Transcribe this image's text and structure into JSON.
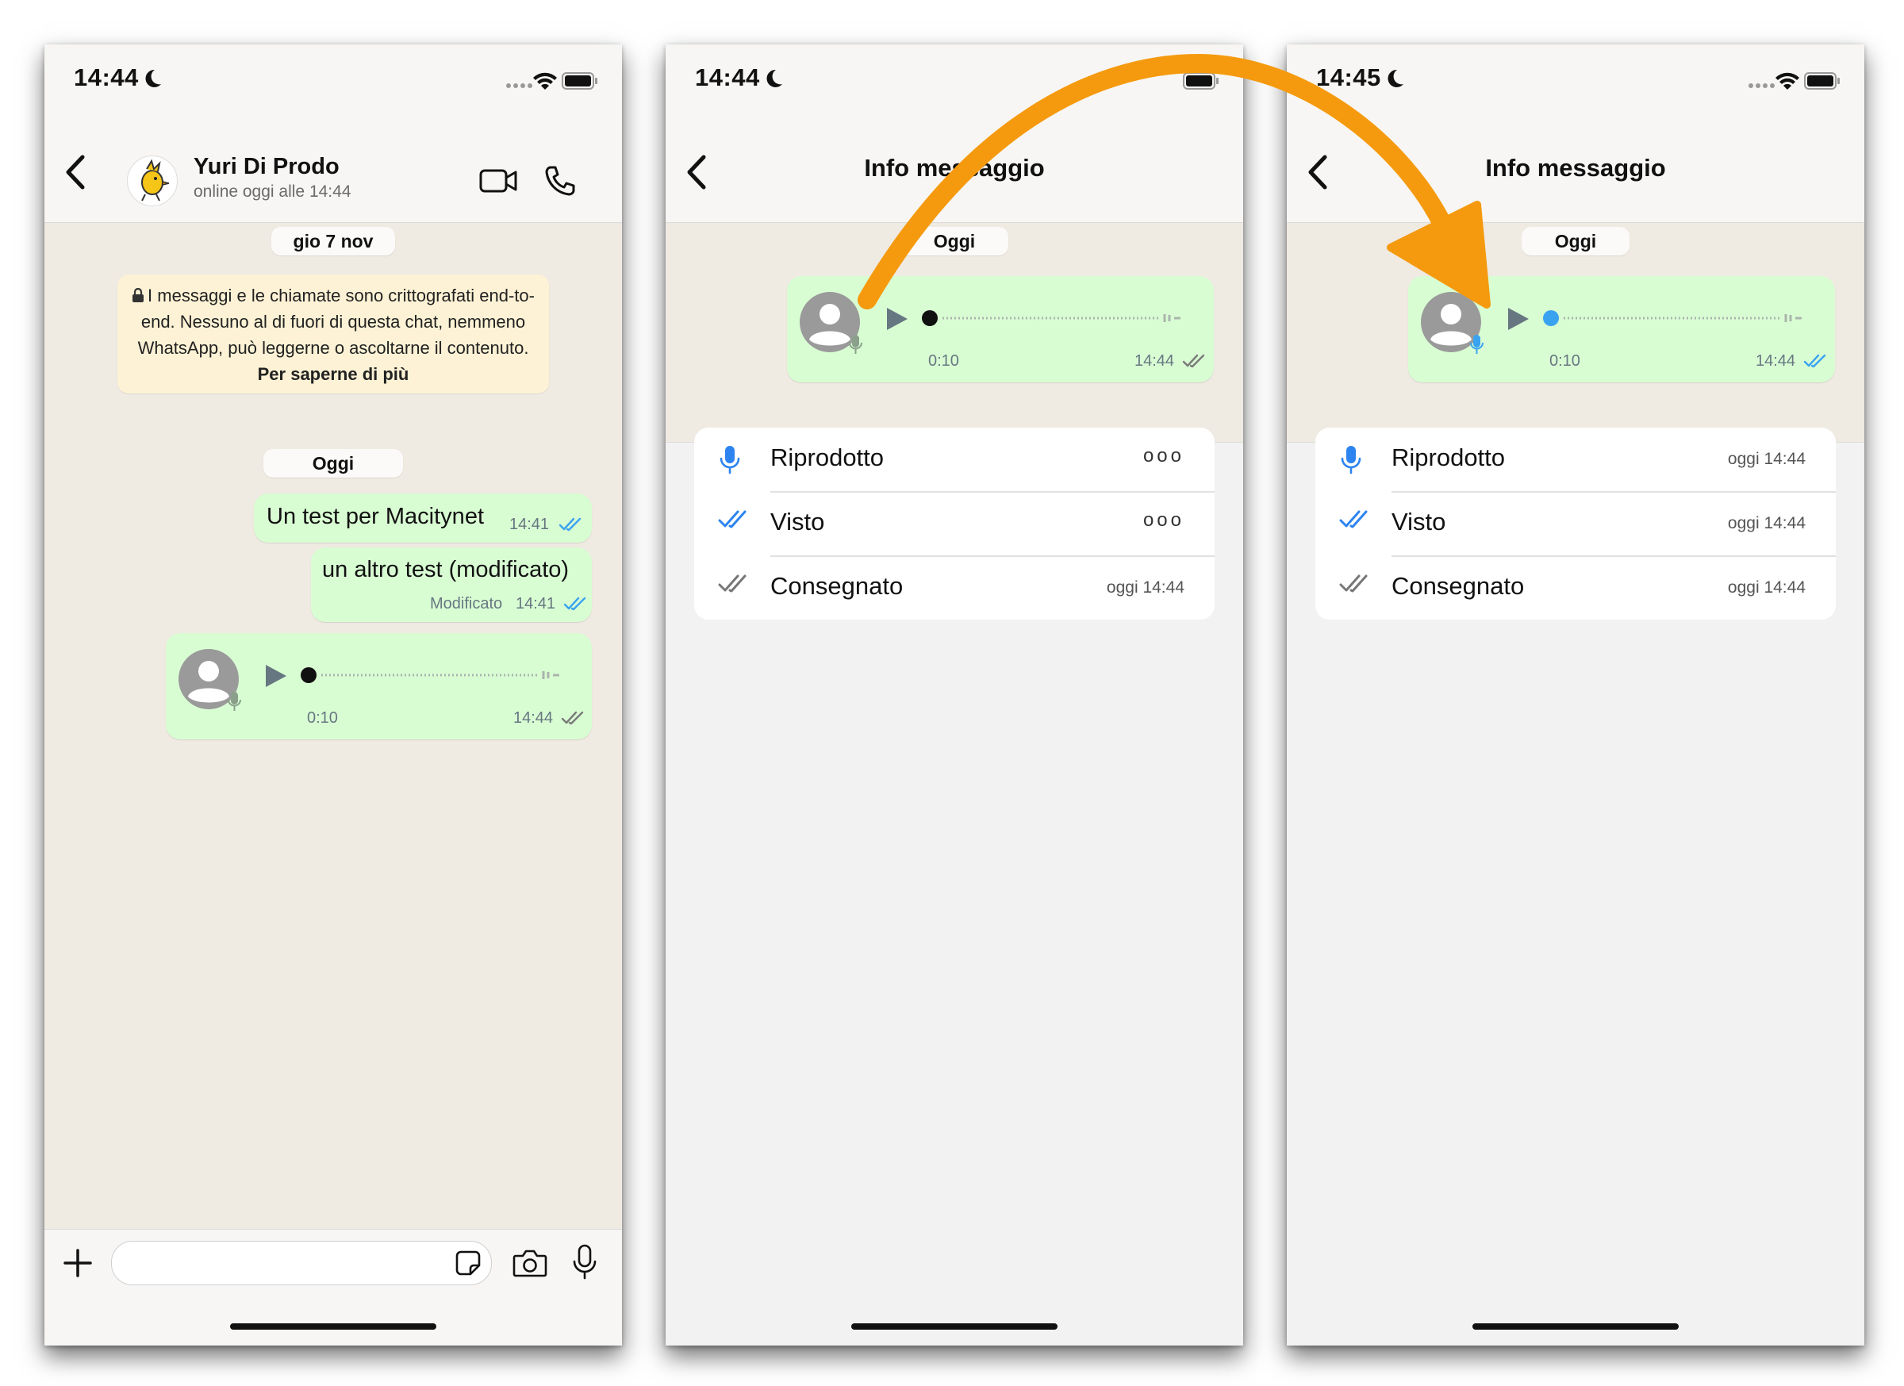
{
  "screens": [
    {
      "status_time": "14:44",
      "contact_name": "Yuri Di Prodo",
      "contact_status": "online oggi alle 14:44",
      "date_pill": "gio 7 nov",
      "encryption_notice": "I messaggi e le chiamate sono crittografati end-to-end. Nessuno al di fuori di questa chat, nemmeno WhatsApp, può leggerne o ascoltarne il contenuto.",
      "encryption_link": "Per saperne di più",
      "today_pill": "Oggi",
      "messages": [
        {
          "text": "Un test per Macitynet",
          "time": "14:41",
          "ticks": "read"
        },
        {
          "text": "un altro test (modificato)",
          "edited_label": "Modificato",
          "time": "14:41",
          "ticks": "read"
        },
        {
          "type": "voice",
          "duration": "0:10",
          "time": "14:44",
          "ticks": "delivered"
        }
      ]
    },
    {
      "status_time": "14:44",
      "title": "Info messaggio",
      "today_pill": "Oggi",
      "voice": {
        "duration": "0:10",
        "time": "14:44",
        "ticks": "delivered"
      },
      "rows": [
        {
          "label": "Riprodotto",
          "value": "ooo"
        },
        {
          "label": "Visto",
          "value": "ooo"
        },
        {
          "label": "Consegnato",
          "value": "oggi 14:44"
        }
      ]
    },
    {
      "status_time": "14:45",
      "title": "Info messaggio",
      "today_pill": "Oggi",
      "voice": {
        "duration": "0:10",
        "time": "14:44",
        "ticks": "read"
      },
      "rows": [
        {
          "label": "Riprodotto",
          "value": "oggi 14:44"
        },
        {
          "label": "Visto",
          "value": "oggi 14:44"
        },
        {
          "label": "Consegnato",
          "value": "oggi 14:44"
        }
      ]
    }
  ],
  "colors": {
    "accent_arrow": "#f59a0e",
    "bubble_green": "#d9fdd3",
    "read_blue": "#3aa3f0",
    "chat_bg": "#efeae2"
  }
}
